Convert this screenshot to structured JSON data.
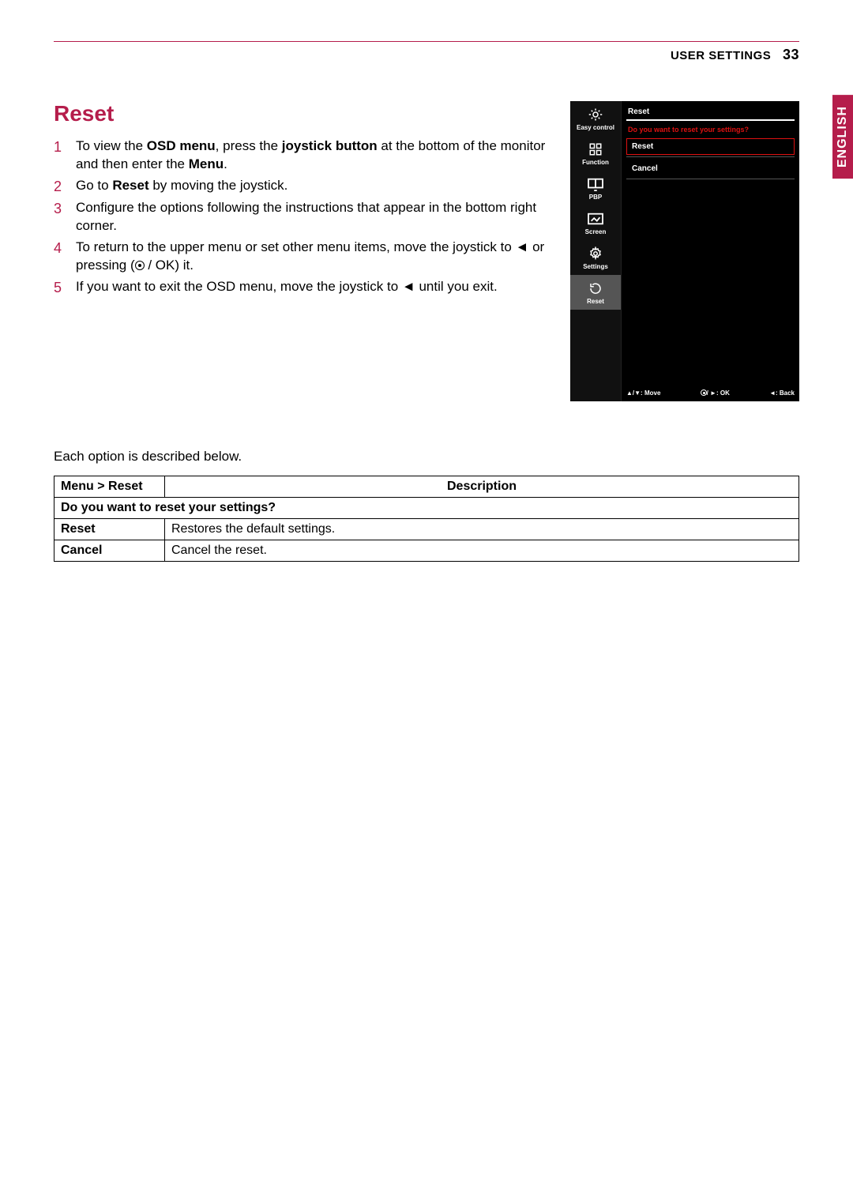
{
  "header": {
    "section": "USER SETTINGS",
    "page": "33"
  },
  "language_tab": "ENGLISH",
  "title": "Reset",
  "steps": [
    {
      "n": "1",
      "pre": "To view the ",
      "b1": "OSD menu",
      "mid1": ", press the ",
      "b2": "joystick button",
      "mid2": " at the bottom of the monitor and then enter the ",
      "b3": "Menu",
      "post": "."
    },
    {
      "n": "2",
      "pre": "Go to ",
      "b1": "Reset",
      "post": " by moving the joystick."
    },
    {
      "n": "3",
      "plain": "Configure the options following the instructions that appear in the bottom right corner."
    },
    {
      "n": "4",
      "plain_a": "To return to the upper menu or set other menu items, move the joystick to ",
      "arrow": "◄",
      "plain_b": " or pressing (",
      "ok": " / OK) it."
    },
    {
      "n": "5",
      "plain_a": "If you want to exit the OSD menu, move the joystick to ",
      "arrow": "◄",
      "plain_b": " until you exit."
    }
  ],
  "osd": {
    "sidebar": [
      {
        "label": "Easy control"
      },
      {
        "label": "Function"
      },
      {
        "label": "PBP"
      },
      {
        "label": "Screen"
      },
      {
        "label": "Settings"
      },
      {
        "label": "Reset"
      }
    ],
    "title": "Reset",
    "question": "Do you want to reset your settings?",
    "options": [
      "Reset",
      "Cancel"
    ],
    "footer": {
      "move": "▲/▼: Move",
      "ok": "/ ►: OK",
      "back": "◄: Back"
    }
  },
  "below_note": "Each option is described below.",
  "table": {
    "head_menu": "Menu > Reset",
    "head_desc": "Description",
    "question_row": "Do you want to reset your settings?",
    "rows": [
      {
        "k": "Reset",
        "v": "Restores the default settings."
      },
      {
        "k": "Cancel",
        "v": "Cancel the reset."
      }
    ]
  }
}
